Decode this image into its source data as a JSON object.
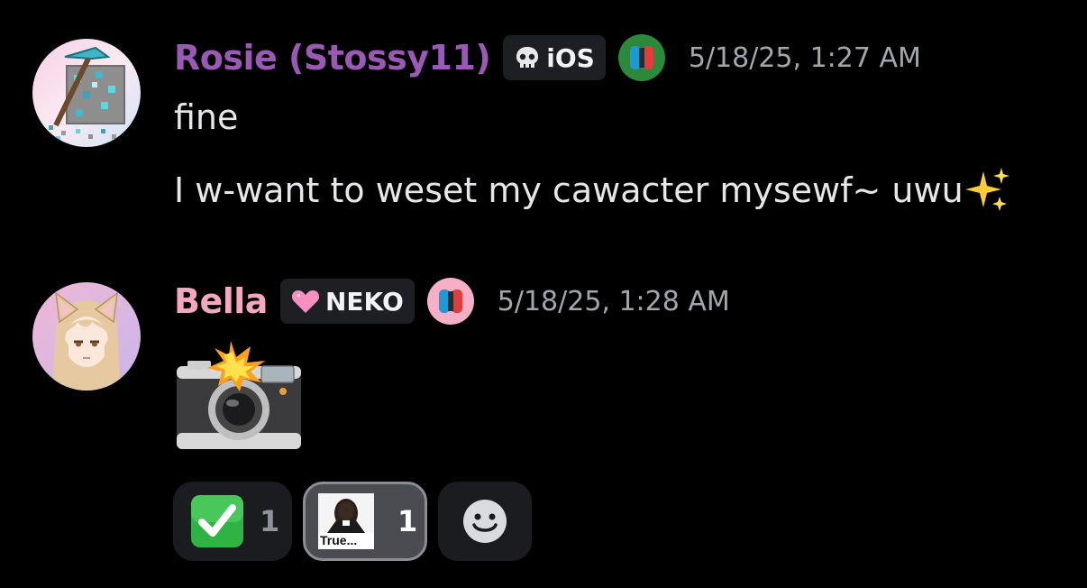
{
  "messages": [
    {
      "author": "Rosie (Stossy11)",
      "author_color": "#9a59b5",
      "tag": {
        "label": "iOS",
        "icon": "skull-icon"
      },
      "platform_icon": "nintendo-switch-icon",
      "timestamp": "5/18/25, 1:27 AM",
      "lines": [
        "fine",
        "I w-want to weset my cawacter mysewf~ uwu"
      ],
      "trailing_emoji": "sparkles-emoji"
    },
    {
      "author": "Bella",
      "author_color": "#f4a7c0",
      "tag": {
        "label": "NEKO",
        "icon": "pink-heart-icon"
      },
      "platform_icon": "nintendo-switch-icon",
      "timestamp": "5/18/25, 1:28 AM",
      "attachment": "camera-with-flash-emoji",
      "reactions": [
        {
          "emoji": "check-mark-button-emoji",
          "count": "1",
          "active": false
        },
        {
          "emoji": "custom-emoji-true",
          "label": "True...",
          "count": "1",
          "active": true
        },
        {
          "emoji": "add-reaction-icon",
          "count": "",
          "active": false
        }
      ]
    }
  ]
}
